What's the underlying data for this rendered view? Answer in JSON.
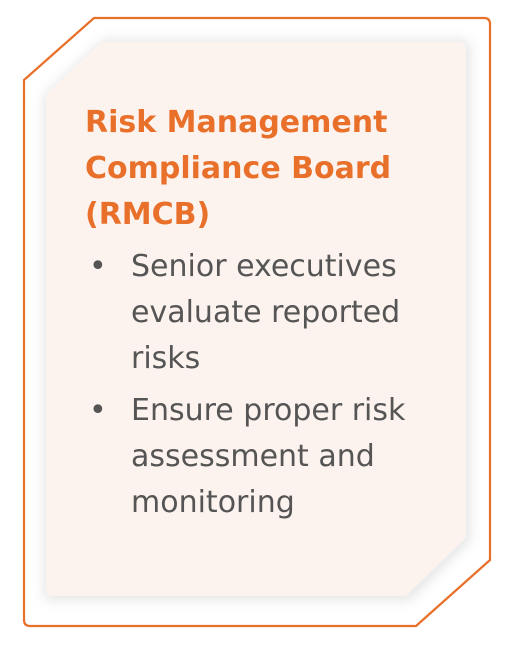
{
  "colors": {
    "accent": "#e8702a",
    "card_fill": "#fdf3ee",
    "text": "#555555"
  },
  "card": {
    "title_lines": [
      "Risk Management",
      "Compliance Board",
      "(RMCB)"
    ],
    "bullets": [
      {
        "lines": [
          "Senior executives",
          "evaluate reported",
          "risks"
        ]
      },
      {
        "lines": [
          "Ensure proper risk",
          "assessment and",
          "monitoring"
        ]
      }
    ]
  }
}
